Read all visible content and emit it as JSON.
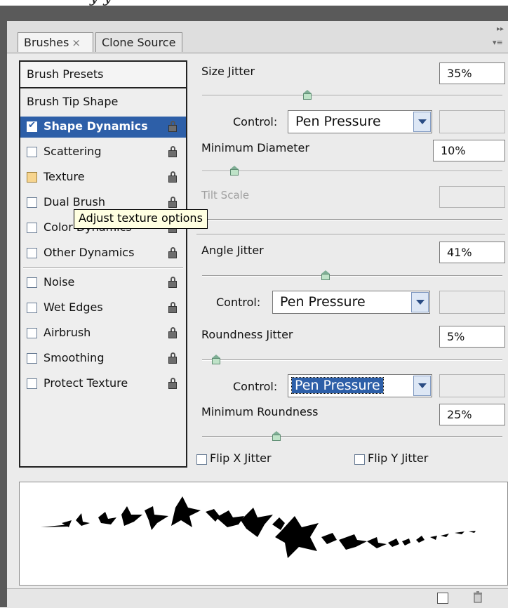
{
  "tabs": [
    {
      "label": "Brushes",
      "close": "×",
      "active": true
    },
    {
      "label": "Clone Source",
      "active": false
    }
  ],
  "left_panel": {
    "presets_label": "Brush Presets",
    "tip_shape_label": "Brush Tip Shape",
    "items": [
      {
        "label": "Shape Dynamics",
        "checked": true,
        "selected": true
      },
      {
        "label": "Scattering",
        "checked": false
      },
      {
        "label": "Texture",
        "checked": false
      },
      {
        "label": "Dual Brush",
        "checked": false
      },
      {
        "label": "Color Dynamics",
        "checked": false
      },
      {
        "label": "Other Dynamics",
        "checked": false
      },
      {
        "label": "Noise",
        "checked": false
      },
      {
        "label": "Wet Edges",
        "checked": false
      },
      {
        "label": "Airbrush",
        "checked": false
      },
      {
        "label": "Smoothing",
        "checked": false
      },
      {
        "label": "Protect Texture",
        "checked": false
      }
    ]
  },
  "tooltip": "Adjust texture options",
  "settings": {
    "size_jitter": {
      "label": "Size Jitter",
      "value": "35%",
      "slider": 0.35
    },
    "size_control": {
      "label": "Control:",
      "value": "Pen Pressure"
    },
    "min_diameter": {
      "label": "Minimum Diameter",
      "value": "10%",
      "slider": 0.1
    },
    "tilt_scale": {
      "label": "Tilt Scale",
      "value": ""
    },
    "angle_jitter": {
      "label": "Angle Jitter",
      "value": "41%",
      "slider": 0.41
    },
    "angle_control": {
      "label": "Control:",
      "value": "Pen Pressure"
    },
    "roundness_jitter": {
      "label": "Roundness Jitter",
      "value": "5%",
      "slider": 0.05
    },
    "roundness_control": {
      "label": "Control:",
      "value": "Pen Pressure"
    },
    "min_roundness": {
      "label": "Minimum Roundness",
      "value": "25%",
      "slider": 0.25
    },
    "flip_x": {
      "label": "Flip X Jitter",
      "checked": false
    },
    "flip_y": {
      "label": "Flip Y Jitter",
      "checked": false
    }
  },
  "colors": {
    "selection": "#2d5fa8",
    "panel_bg": "#ebebeb",
    "frame_dark": "#5a5a5a",
    "tooltip_bg": "#ffffe1",
    "slider_thumb": "#bfe3c8"
  },
  "icons": {
    "lock": "lock-icon",
    "new_preset": "new-brush-icon",
    "delete": "trash-icon"
  }
}
